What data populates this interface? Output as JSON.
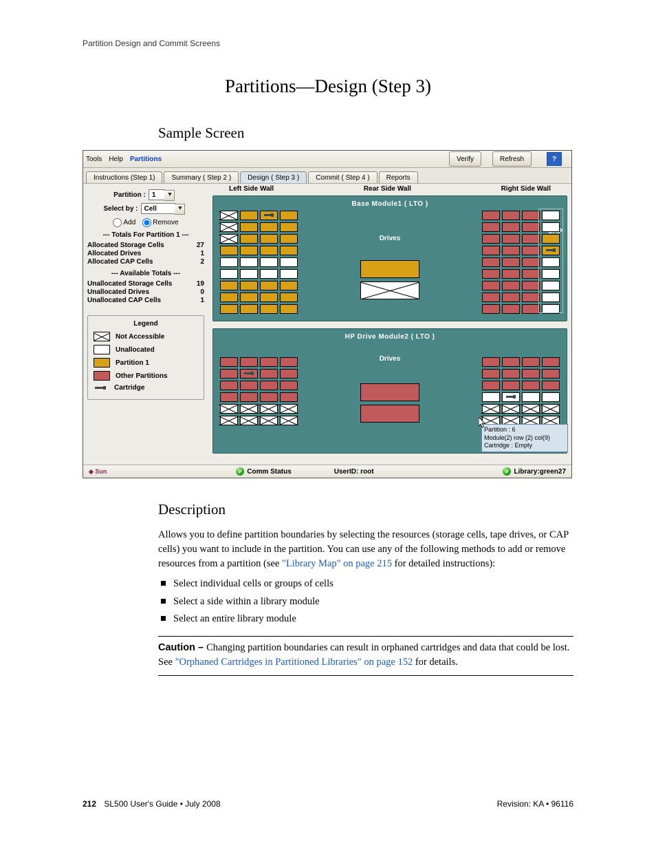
{
  "header": {
    "running_head": "Partition Design and Commit Screens"
  },
  "title": "Partitions—Design (Step 3)",
  "sections": {
    "sample_screen": "Sample Screen",
    "description": "Description"
  },
  "app": {
    "menus": {
      "tools": "Tools",
      "help": "Help",
      "partitions": "Partitions"
    },
    "buttons": {
      "verify": "Verify",
      "refresh": "Refresh",
      "help": "?"
    },
    "tabs": {
      "instructions": "Instructions (Step 1)",
      "summary": "Summary ( Step 2 )",
      "design": "Design ( Step 3 )",
      "commit": "Commit ( Step 4 )",
      "reports": "Reports"
    },
    "walls": {
      "left": "Left Side Wall",
      "rear": "Rear Side Wall",
      "right": "Right Side Wall"
    },
    "side": {
      "partition_label": "Partition :",
      "partition_value": "1",
      "selectby_label": "Select by :",
      "selectby_value": "Cell",
      "add": "Add",
      "remove": "Remove",
      "totals_hdr": "--- Totals For Partition 1 ---",
      "alloc_storage_label": "Allocated Storage Cells",
      "alloc_storage_val": "27",
      "alloc_drives_label": "Allocated Drives",
      "alloc_drives_val": "1",
      "alloc_cap_label": "Allocated CAP Cells",
      "alloc_cap_val": "2",
      "avail_hdr": "--- Available Totals ---",
      "unalloc_storage_label": "Unallocated Storage Cells",
      "unalloc_storage_val": "19",
      "unalloc_drives_label": "Unallocated Drives",
      "unalloc_drives_val": "0",
      "unalloc_cap_label": "Unallocated CAP Cells",
      "unalloc_cap_val": "1",
      "legend_title": "Legend",
      "legend_na": "Not Accessible",
      "legend_unalloc": "Unallocated",
      "legend_p1": "Partition  1",
      "legend_other": "Other Partitions",
      "legend_cart": "Cartridge"
    },
    "module1": {
      "title": "Base Module1   ( LTO )",
      "drives_label": "Drives",
      "cap_label": "CAP"
    },
    "module2": {
      "title": "HP Drive Module2   ( LTO )",
      "drives_label": "Drives"
    },
    "tooltip": {
      "l1": "Partition : 6",
      "l2": "Module(2) row (2) col(9)",
      "l3": "Cartridge : Empty"
    },
    "status": {
      "comm": "Comm Status",
      "user": "UserID: root",
      "library": "Library:green27",
      "sun": "◆ Sun"
    }
  },
  "description": {
    "para_pre": "Allows you to define partition boundaries by selecting the resources (storage cells, tape drives, or CAP cells) you want to include in the partition. You can use any of the following methods to add or remove resources from a partition (see ",
    "link1": "\"Library Map\" on page 215",
    "para_post": " for detailed instructions):",
    "bullets": [
      "Select individual cells or groups of cells",
      "Select a side within a library module",
      "Select an entire library module"
    ],
    "caution_lead": "Caution – ",
    "caution_pre": "Changing partition boundaries can result in orphaned cartridges and data that could be lost. See ",
    "caution_link": "\"Orphaned Cartridges in Partitioned Libraries\" on page 152",
    "caution_post": " for details."
  },
  "footer": {
    "pageno": "212",
    "left": "SL500 User's Guide  •  July 2008",
    "right": "Revision: KA  •  96116"
  }
}
